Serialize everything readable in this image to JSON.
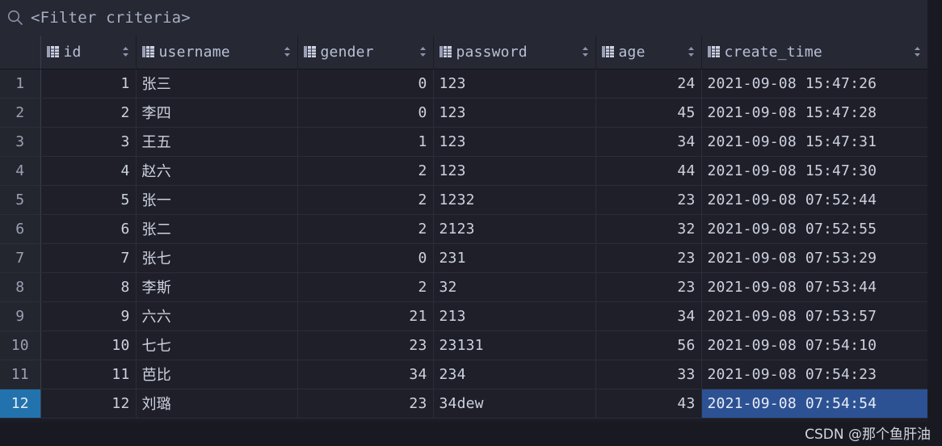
{
  "filter": {
    "icon": "search-icon",
    "placeholder": "<Filter criteria>",
    "value": ""
  },
  "colors": {
    "background": "#1b1c25",
    "header_background": "#262833",
    "row_background": "#1e1f29",
    "row_header_background": "#24262f",
    "selected_row_header": "#2273ad",
    "selected_cell": "#2d5294",
    "text": "#cdd2de",
    "header_text": "#b7c0d6",
    "grid_line": "#2b2d3a"
  },
  "table": {
    "columns": [
      {
        "key": "rownum",
        "label": "",
        "icon": "",
        "sortable": false,
        "align": "center"
      },
      {
        "key": "id",
        "label": "id",
        "icon": "table-column-icon",
        "sortable": true,
        "align": "right"
      },
      {
        "key": "username",
        "label": "username",
        "icon": "table-column-icon",
        "sortable": true,
        "align": "left"
      },
      {
        "key": "gender",
        "label": "gender",
        "icon": "table-column-icon",
        "sortable": true,
        "align": "right"
      },
      {
        "key": "password",
        "label": "password",
        "icon": "table-column-icon",
        "sortable": true,
        "align": "left"
      },
      {
        "key": "age",
        "label": "age",
        "icon": "table-column-icon",
        "sortable": true,
        "align": "right"
      },
      {
        "key": "create_time",
        "label": "create_time",
        "icon": "table-column-icon",
        "sortable": true,
        "align": "left"
      }
    ],
    "rows": [
      {
        "rownum": "1",
        "id": "1",
        "username": "张三",
        "gender": "0",
        "password": "123",
        "age": "24",
        "create_time": "2021-09-08 15:47:26"
      },
      {
        "rownum": "2",
        "id": "2",
        "username": "李四",
        "gender": "0",
        "password": "123",
        "age": "45",
        "create_time": "2021-09-08 15:47:28"
      },
      {
        "rownum": "3",
        "id": "3",
        "username": "王五",
        "gender": "1",
        "password": "123",
        "age": "34",
        "create_time": "2021-09-08 15:47:31"
      },
      {
        "rownum": "4",
        "id": "4",
        "username": "赵六",
        "gender": "2",
        "password": "123",
        "age": "44",
        "create_time": "2021-09-08 15:47:30"
      },
      {
        "rownum": "5",
        "id": "5",
        "username": "张一",
        "gender": "2",
        "password": "1232",
        "age": "23",
        "create_time": "2021-09-08 07:52:44"
      },
      {
        "rownum": "6",
        "id": "6",
        "username": "张二",
        "gender": "2",
        "password": "2123",
        "age": "32",
        "create_time": "2021-09-08 07:52:55"
      },
      {
        "rownum": "7",
        "id": "7",
        "username": "张七",
        "gender": "0",
        "password": "231",
        "age": "23",
        "create_time": "2021-09-08 07:53:29"
      },
      {
        "rownum": "8",
        "id": "8",
        "username": "李斯",
        "gender": "2",
        "password": "32",
        "age": "23",
        "create_time": "2021-09-08 07:53:44"
      },
      {
        "rownum": "9",
        "id": "9",
        "username": "六六",
        "gender": "21",
        "password": "213",
        "age": "34",
        "create_time": "2021-09-08 07:53:57"
      },
      {
        "rownum": "10",
        "id": "10",
        "username": "七七",
        "gender": "23",
        "password": "23131",
        "age": "56",
        "create_time": "2021-09-08 07:54:10"
      },
      {
        "rownum": "11",
        "id": "11",
        "username": "芭比",
        "gender": "34",
        "password": "234",
        "age": "33",
        "create_time": "2021-09-08 07:54:23"
      },
      {
        "rownum": "12",
        "id": "12",
        "username": "刘璐",
        "gender": "23",
        "password": "34dew",
        "age": "43",
        "create_time": "2021-09-08 07:54:54"
      }
    ],
    "selected_row_index": 11,
    "selected_column_key": "create_time"
  },
  "footer": {
    "watermark": "CSDN @那个鱼肝油"
  }
}
